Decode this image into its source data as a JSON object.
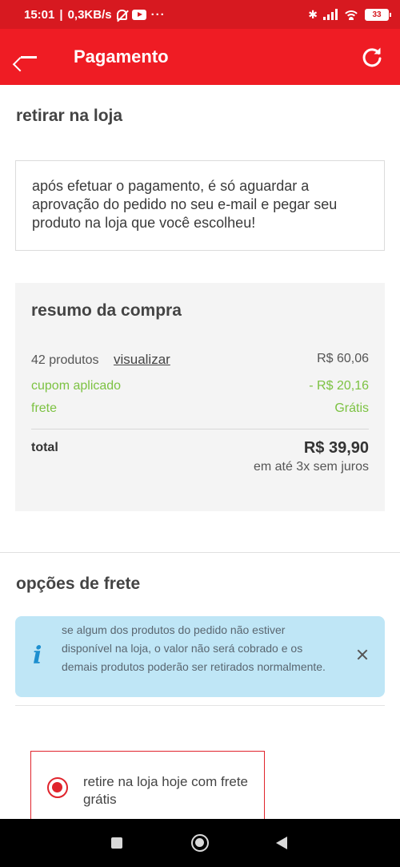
{
  "status_bar": {
    "time": "15:01",
    "network_speed": "0,3KB/s",
    "more": "···",
    "battery": "33"
  },
  "app_bar": {
    "title": "Pagamento"
  },
  "pickup": {
    "title": "retirar na loja",
    "message": "após efetuar o pagamento, é só aguardar a aprovação do pedido no seu e-mail e pegar seu produto na loja que você escolheu!"
  },
  "summary": {
    "title": "resumo da compra",
    "products_label": "42 produtos",
    "view_link": "visualizar",
    "products_value": "R$ 60,06",
    "coupon_label": "cupom aplicado",
    "coupon_value": "- R$ 20,16",
    "shipping_label": "frete",
    "shipping_value": "Grátis",
    "total_label": "total",
    "total_value": "R$ 39,90",
    "installments": "em até 3x sem juros"
  },
  "shipping_options": {
    "title": "opções de frete",
    "info_icon": "i",
    "info_text": "se algum dos produtos do pedido não estiver disponível na loja, o valor não será cobrado e os demais produtos poderão ser retirados normalmente.",
    "option_label": "retire na loja hoje com frete grátis"
  },
  "colors": {
    "brand_red": "#ef1c24",
    "status_red": "#d71920",
    "green": "#7cc242",
    "info_bg": "#bfe6f6",
    "info_icon": "#1e8fcf"
  }
}
